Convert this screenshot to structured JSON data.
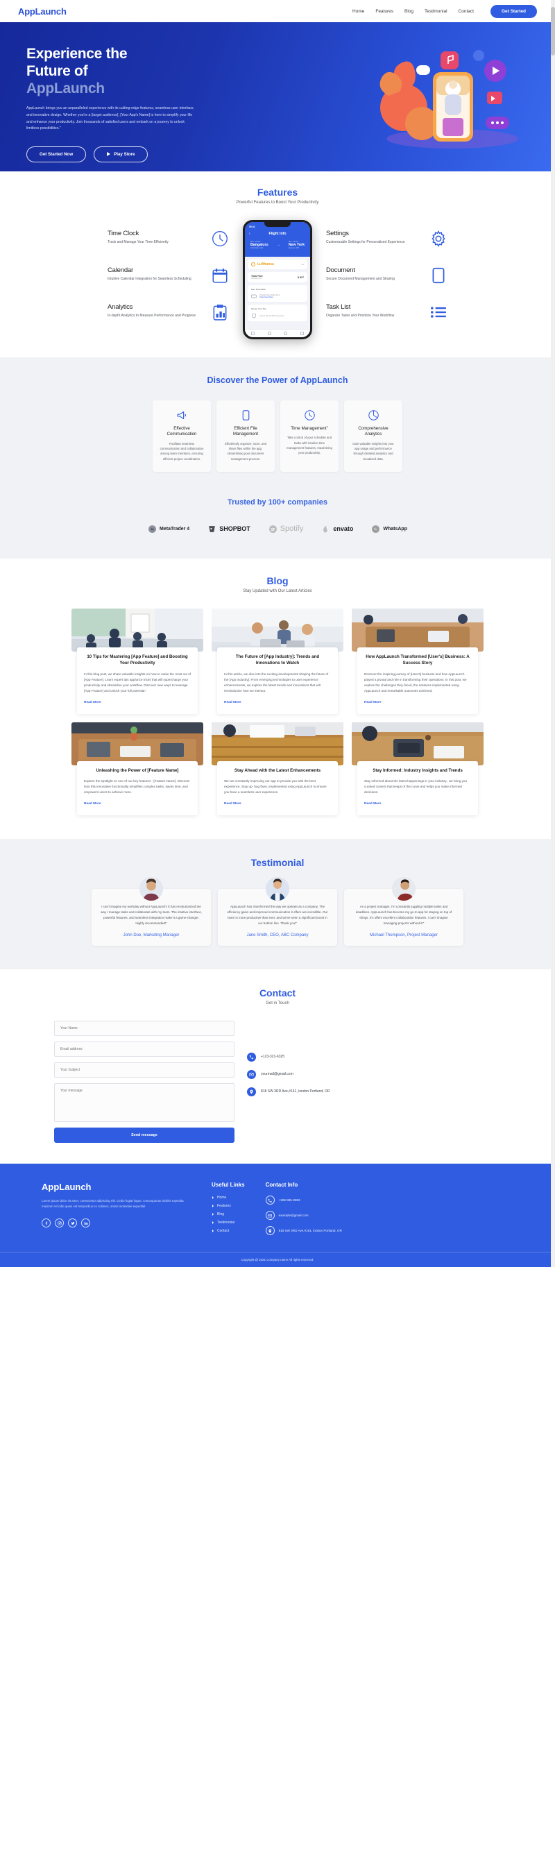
{
  "nav": {
    "brand": "AppLaunch",
    "links": [
      {
        "label": "Home"
      },
      {
        "label": "Features"
      },
      {
        "label": "Blog"
      },
      {
        "label": "Testimonial"
      },
      {
        "label": "Contact"
      }
    ],
    "cta": "Get Started"
  },
  "hero": {
    "title_line1": "Experience the",
    "title_line2": "Future of",
    "title_line3": "AppLaunch",
    "paragraph": "AppLaunch brings you an unparalleled experience with its cutting-edge features, seamless user interface, and innovative design. Whether you're a [target audience], [Your App's Name] is here to simplify your life and enhance your productivity. Join thousands of satisfied users and embark on a journey to unlock limitless possibilities.\"",
    "btn_primary": "Get Started Now",
    "btn_secondary": "Play Store"
  },
  "features": {
    "title": "Features",
    "subtitle": "Powerful Features to Boost Your Productivity",
    "left": [
      {
        "name": "Time Clock",
        "desc": "Track and Manage Your Time Efficiently",
        "icon": "clock-icon"
      },
      {
        "name": "Calendar",
        "desc": "Intuitive Calendar Integration for Seamless Scheduling",
        "icon": "calendar-icon"
      },
      {
        "name": "Analytics",
        "desc": "In-depth Analytics to Measure Performance and Progress",
        "icon": "analytics-icon"
      }
    ],
    "right": [
      {
        "name": "Settings",
        "desc": "Customizable Settings for Personalized Experience",
        "icon": "gear-icon"
      },
      {
        "name": "Document",
        "desc": "Secure Document Management and Sharing",
        "icon": "document-icon"
      },
      {
        "name": "Task List",
        "desc": "Organize Tasks and Prioritize Your Workflow",
        "icon": "list-icon"
      }
    ],
    "phone": {
      "status_time": "09:41",
      "screen_title": "Flight Info",
      "back": "‹",
      "origin_date": "Mon, 14 Dec",
      "origin_city": "Bangaluru",
      "origin_sub": "Karnataka, India",
      "arrow": "→",
      "dest_date": "Mon, 15 Dec",
      "dest_city": "New York",
      "dest_sub": "Queens, USA",
      "airline": "Lufthansa",
      "airline_code": "LH",
      "total_fare_label": "Total Fare",
      "total_fare_sub": "Including Tax",
      "total_fare_value": "$ 527",
      "fare_info_label": "Fare Information",
      "fare_refund": "Partially Refundable Fare",
      "fare_rules_link": "View Fare Rules",
      "secure_label": "Secure Your Trip",
      "secure_item": "Secure My Trip With Insurance"
    }
  },
  "discover": {
    "title": "Discover the Power of AppLaunch",
    "cards": [
      {
        "icon": "megaphone-icon",
        "heading": "Effective Communication",
        "text": "Facilitate seamless communication and collaboration among team members, ensuring efficient project coordination."
      },
      {
        "icon": "file-icon",
        "heading": "Efficient File Management",
        "text": "Effortlessly organize, store, and share files within the app, streamlining your document management process."
      },
      {
        "icon": "clock-icon",
        "heading": "Time Management\"",
        "text": "Take control of your schedule and tasks with intuitive time management features, maximizing your productivity."
      },
      {
        "icon": "pie-chart-icon",
        "heading": "Comprehensive Analytics",
        "text": "Gain valuable insights into your app usage and performance through detailed analytics and visualized data."
      }
    ]
  },
  "trusted": {
    "title": "Trusted by 100+ companies",
    "logos": [
      {
        "name": "MetaTrader 4"
      },
      {
        "name": "SHOPBOT"
      },
      {
        "name": "Spotify"
      },
      {
        "name": "envato"
      },
      {
        "name": "WhatsApp"
      }
    ]
  },
  "blog": {
    "title": "Blog",
    "subtitle": "Stay Updated with Our Latest Articles",
    "read_more": "Read More",
    "posts": [
      {
        "heading": "10 Tips for Mastering [App Feature] and Boosting Your Productivity",
        "text": "In this blog post, we share valuable insights on how to make the most out of [App Feature]. Learn expert tips applunce tricks that will supercharge your productivity and streamline your workflow. Discover new ways to leverage [App Feature] and unlock your full potential.\"",
        "image": "meeting-whiteboard"
      },
      {
        "heading": "The Future of [App Industry]: Trends and Innovations to Watch",
        "text": "In this article, we dive into the exciting developments shaping the future of the [App Industry]. From emerging technologies to user experience enhancements, we explore the latest trends and innovations that will revolutionize how we interact.",
        "image": "team-laptops"
      },
      {
        "heading": "How AppLaunch Transformed [User's] Business: A Success Story",
        "text": "Discover the inspiring journey of [User's] business and how AppLaunch played a pivotal and role in transforming their operations. In this post, we explore the challenges they faced, the solutions implemented using AppLaunch and remarkable outcomes achieved.",
        "image": "office-table"
      },
      {
        "heading": "Unleashing the Power of [Feature Name]",
        "text": "Explore the spotlight on one of our key features - [Feature Name]. Discover how this innovative functionality simplifies complex tasks, saves time, and empowers users to achieve more.",
        "image": "desk-coworkers"
      },
      {
        "heading": "Stay Ahead with the Latest Enhancements",
        "text": "We are constantly improving our app to provide you with the best experience. Stay up- bug fixes, implemented using AppLaunch to ensure you have a seamless user experience.",
        "image": "wood-table-meeting"
      },
      {
        "heading": "Stay Informed: Industry Insights and Trends",
        "text": "Stay informed about the latest happenings in your industry., we bring you curated content that keeps of the curve and helps you make informed decisions.",
        "image": "desk-typewriter"
      }
    ]
  },
  "testimonial": {
    "title": "Testimonial",
    "items": [
      {
        "quote": "I can't imagine my workday without AppLaunch! It has revolutionized the way I manage tasks and collaborate with my team. The intuitive interface, powerful features, and seamless integration make it a game-changer. Highly recommended!\"",
        "name": "John Doe, Marketing Manager",
        "avatar": "avatar-man-beard"
      },
      {
        "quote": "AppLaunch has transformed the way we operate as a company. The efficiency gains and improved communication it offers are incredible. Our team is more productive than ever, and we've seen a significant boost in our bottom line. Thank you!\"",
        "name": "Jane Smith, CEO, ABC Company",
        "avatar": "avatar-man-suit"
      },
      {
        "quote": "As a project manager, I'm constantly juggling multiple tasks and deadlines. AppLaunch has become my go-to app for staying on top of things. It's offers excellent collaboration features. I can't imagine managing projects without it!\"",
        "name": "Michael Thompson, Project Manager",
        "avatar": "avatar-man-red"
      }
    ]
  },
  "contact": {
    "title": "Contact",
    "subtitle": "Get in Touch",
    "fields": {
      "name_placeholder": "Your Name",
      "email_placeholder": "Email address",
      "subject_placeholder": "Your Subject",
      "message_placeholder": "Your message"
    },
    "submit": "Send message",
    "info": [
      {
        "icon": "phone-icon",
        "text": "+123-321-6325"
      },
      {
        "icon": "mail-icon",
        "text": "yourmail@gmail.com"
      },
      {
        "icon": "location-icon",
        "text": "818 SW 3RD Ave,#161, london Portland, OR"
      }
    ]
  },
  "footer": {
    "brand": "AppLaunch",
    "about": "Lorem ipsum dolor sit amet, consectetur adipiscing elit. Cedio fugiat fugue, consequuntur debitis expedita maxime! Ad odio quasi vel temporibus ex cultores, omnis molestiae expedital",
    "social": [
      "facebook-icon",
      "instagram-icon",
      "twitter-icon",
      "linkedin-icon"
    ],
    "links_title": "Useful Links",
    "links": [
      "Home",
      "Features",
      "Blog",
      "Testimonial",
      "Contact"
    ],
    "contact_title": "Contact Info",
    "contact": [
      {
        "icon": "phone-icon",
        "text": "+369 985-8953"
      },
      {
        "icon": "mail-icon",
        "text": "example@gmail.com"
      },
      {
        "icon": "location-icon",
        "text": "818 SW 3RD Ave,#161, london Portland, OR"
      }
    ],
    "copyright": "Copyright @ 2021 Company name All rights reserved."
  }
}
